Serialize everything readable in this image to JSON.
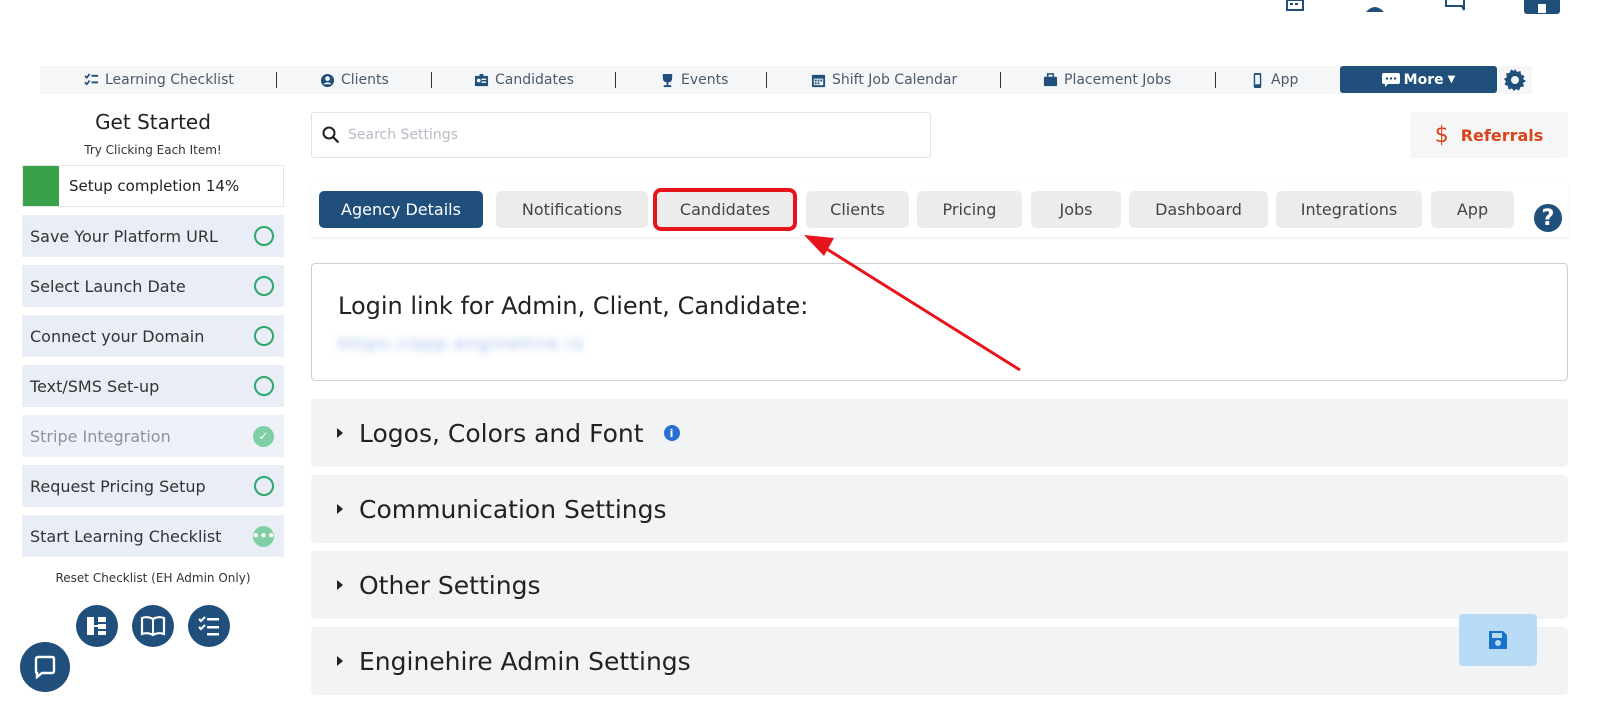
{
  "nav": {
    "items": [
      {
        "label": "Learning Checklist",
        "icon": "checklist-icon"
      },
      {
        "label": "Clients",
        "icon": "clients-icon"
      },
      {
        "label": "Candidates",
        "icon": "id-card-icon"
      },
      {
        "label": "Events",
        "icon": "trophy-icon"
      },
      {
        "label": "Shift Job Calendar",
        "icon": "calendar-icon"
      },
      {
        "label": "Placement Jobs",
        "icon": "briefcase-icon"
      },
      {
        "label": "App",
        "icon": "mobile-icon"
      }
    ],
    "more_label": "More"
  },
  "sidebar": {
    "title": "Get Started",
    "subtitle": "Try Clicking Each Item!",
    "progress_label": "Setup completion 14%",
    "progress_fraction": 0.14,
    "items": [
      {
        "label": "Save Your Platform URL",
        "status": "todo"
      },
      {
        "label": "Select Launch Date",
        "status": "todo"
      },
      {
        "label": "Connect your Domain",
        "status": "todo"
      },
      {
        "label": "Text/SMS Set-up",
        "status": "todo"
      },
      {
        "label": "Stripe Integration",
        "status": "done"
      },
      {
        "label": "Request Pricing Setup",
        "status": "todo"
      },
      {
        "label": "Start Learning Checklist",
        "status": "in-progress"
      }
    ],
    "reset_label": "Reset Checklist (EH Admin Only)"
  },
  "search": {
    "placeholder": "Search Settings"
  },
  "referrals_label": "Referrals",
  "tabs": [
    {
      "label": "Agency Details",
      "active": true
    },
    {
      "label": "Notifications"
    },
    {
      "label": "Candidates",
      "highlighted": true
    },
    {
      "label": "Clients"
    },
    {
      "label": "Pricing"
    },
    {
      "label": "Jobs"
    },
    {
      "label": "Dashboard"
    },
    {
      "label": "Integrations"
    },
    {
      "label": "App"
    }
  ],
  "help_label": "?",
  "login": {
    "title": "Login link for Admin, Client, Candidate:",
    "link": "https://app.enginehire.io"
  },
  "sections": [
    {
      "label": "Logos, Colors and Font",
      "info": "i"
    },
    {
      "label": "Communication Settings"
    },
    {
      "label": "Other Settings"
    },
    {
      "label": "Enginehire Admin Settings"
    }
  ],
  "colors": {
    "brand": "#1f4f7a",
    "highlight": "#e8141c",
    "referrals": "#d9441d",
    "progress": "#3aa04a"
  }
}
